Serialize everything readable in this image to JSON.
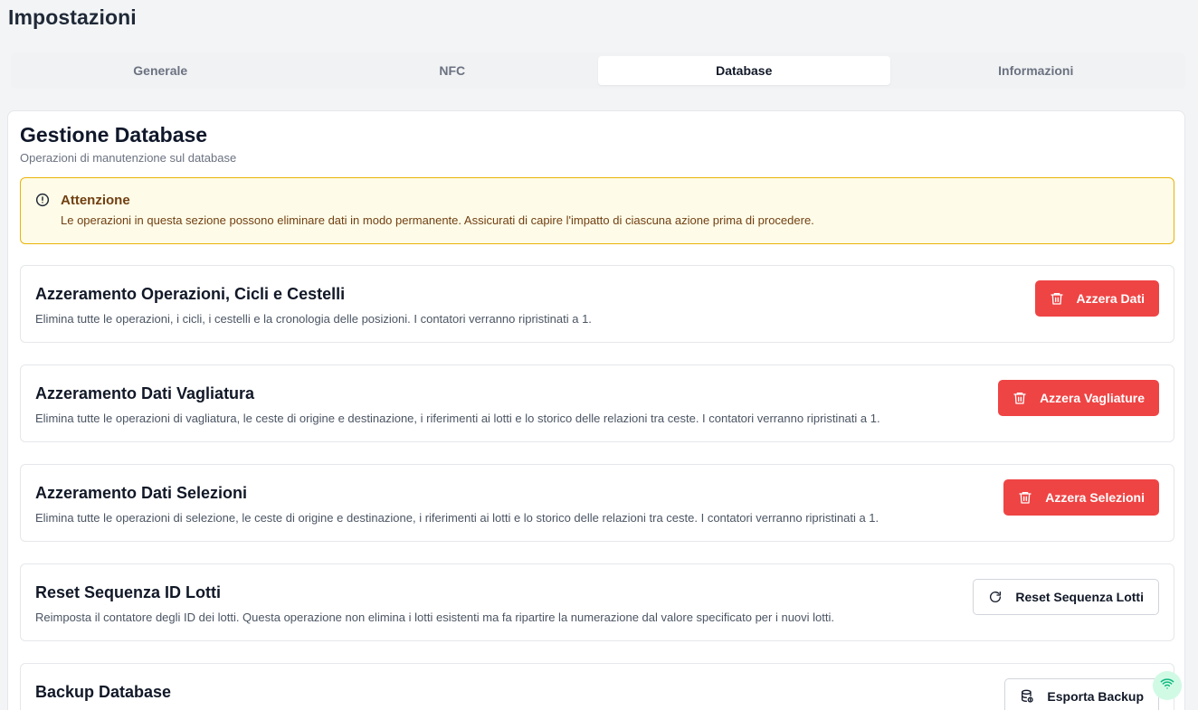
{
  "page": {
    "title": "Impostazioni"
  },
  "tabs": [
    {
      "label": "Generale",
      "active": false
    },
    {
      "label": "NFC",
      "active": false
    },
    {
      "label": "Database",
      "active": true
    },
    {
      "label": "Informazioni",
      "active": false
    }
  ],
  "card": {
    "title": "Gestione Database",
    "subtitle": "Operazioni di manutenzione sul database"
  },
  "alert": {
    "icon": "alert-circle-icon",
    "title": "Attenzione",
    "text": "Le operazioni in questa sezione possono eliminare dati in modo permanente. Assicurati di capire l'impatto di ciascuna azione prima di procedere."
  },
  "sections": [
    {
      "title": "Azzeramento Operazioni, Cicli e Cestelli",
      "description": "Elimina tutte le operazioni, i cicli, i cestelli e la cronologia delle posizioni. I contatori verranno ripristinati a 1.",
      "button_label": "Azzera Dati",
      "button_icon": "trash-icon"
    },
    {
      "title": "Azzeramento Dati Vagliatura",
      "description": "Elimina tutte le operazioni di vagliatura, le ceste di origine e destinazione, i riferimenti ai lotti e lo storico delle relazioni tra ceste. I contatori verranno ripristinati a 1.",
      "button_label": "Azzera Vagliature",
      "button_icon": "trash-icon"
    },
    {
      "title": "Azzeramento Dati Selezioni",
      "description": "Elimina tutte le operazioni di selezione, le ceste di origine e destinazione, i riferimenti ai lotti e lo storico delle relazioni tra ceste. I contatori verranno ripristinati a 1.",
      "button_label": "Azzera Selezioni",
      "button_icon": "trash-icon"
    },
    {
      "title": "Reset Sequenza ID Lotti",
      "description": "Reimposta il contatore degli ID dei lotti. Questa operazione non elimina i lotti esistenti ma fa ripartire la numerazione dal valore specificato per i nuovi lotti.",
      "button_label": "Reset Sequenza Lotti",
      "button_icon": "refresh-icon"
    },
    {
      "title": "Backup Database",
      "description": "",
      "button_label": "Esporta Backup",
      "button_icon": "database-export-icon"
    }
  ],
  "status": {
    "icon": "wifi-icon",
    "color": "#10b981"
  },
  "colors": {
    "danger": "#ef4444",
    "warning_border": "#eab308",
    "warning_bg": "#fefce8",
    "warning_text": "#713f12"
  }
}
